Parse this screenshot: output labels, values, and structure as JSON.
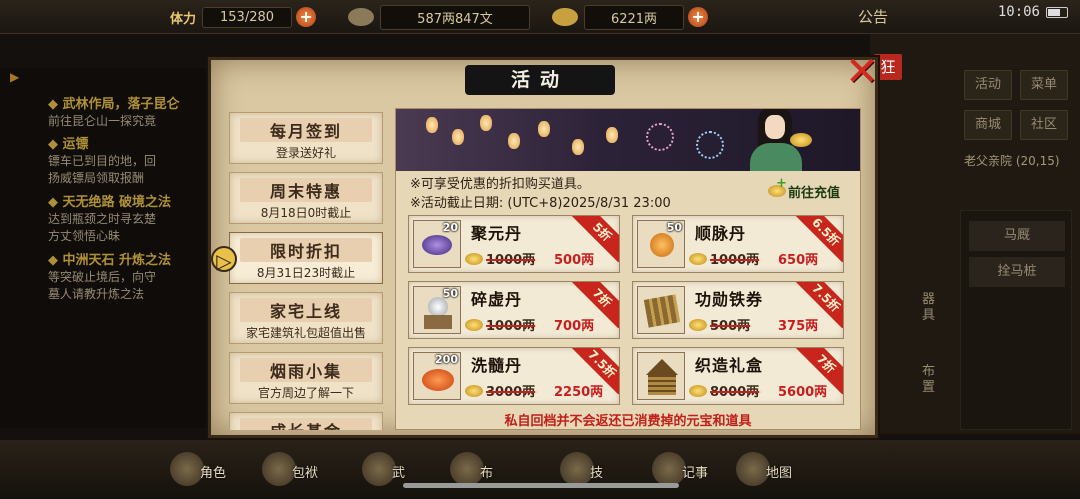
{
  "status_bar": {
    "stamina_label": "体力",
    "stamina_value": "153/280",
    "silver_value": "587两847文",
    "gold_value": "6221两",
    "announcement": "公告",
    "time": "10:06"
  },
  "quests": [
    {
      "title": "◆ 武林作局，落子昆仑",
      "desc": "前往昆仑山一探究竟"
    },
    {
      "title": "◆ 运镖",
      "desc": "镖车已到目的地，回\n扬威镖局领取报酬"
    },
    {
      "title": "◆ 天无绝路 破境之法",
      "desc": "达到瓶颈之时寻玄楚\n方丈领悟心昧"
    },
    {
      "title": "◆ 中洲天石 升炼之法",
      "desc": "等突破止境后，向守\n墓人请教升炼之法"
    }
  ],
  "right_panel": {
    "buttons": [
      "活动",
      "菜单",
      "商城",
      "社区"
    ],
    "location": "老父亲院 (20,15)",
    "list_items": [
      "马厩",
      "拴马桩"
    ],
    "side_labels": [
      "器具",
      "布置"
    ]
  },
  "bottom_nav": [
    "角色",
    "包袱",
    "武",
    "布",
    "技",
    "记事",
    "地图"
  ],
  "dialog": {
    "title": "活动",
    "close_label": "✕",
    "kuang_label": "狂",
    "tabs": [
      {
        "title": "每月签到",
        "subtitle": "登录送好礼"
      },
      {
        "title": "周末特惠",
        "subtitle": "8月18日0时截止"
      },
      {
        "title": "限时折扣",
        "subtitle": "8月31日23时截止"
      },
      {
        "title": "家宅上线",
        "subtitle": "家宅建筑礼包超值出售"
      },
      {
        "title": "烟雨小集",
        "subtitle": "官方周边了解一下"
      },
      {
        "title": "成长基金",
        "subtitle": ""
      }
    ],
    "active_tab": 2,
    "info_line1": "※可享受优惠的折扣购买道具。",
    "info_line2": "※活动截止日期: (UTC+8)2025/8/31 23:00",
    "recharge_label": "前往充值",
    "items": [
      {
        "name": "聚元丹",
        "qty": "20",
        "old_price": "1000两",
        "new_price": "500两",
        "discount": "5折"
      },
      {
        "name": "顺脉丹",
        "qty": "50",
        "old_price": "1000两",
        "new_price": "650两",
        "discount": "6.5折"
      },
      {
        "name": "碎虚丹",
        "qty": "50",
        "old_price": "1000两",
        "new_price": "700两",
        "discount": "7折"
      },
      {
        "name": "功勋铁券",
        "qty": "",
        "old_price": "500两",
        "new_price": "375两",
        "discount": "7.5折"
      },
      {
        "name": "洗髓丹",
        "qty": "200",
        "old_price": "3000两",
        "new_price": "2250两",
        "discount": "7.5折"
      },
      {
        "name": "织造礼盒",
        "qty": "",
        "old_price": "8000两",
        "new_price": "5600两",
        "discount": "7折"
      }
    ],
    "footer_note": "私自回档并不会返还已消费掉的元宝和道具"
  },
  "colors": {
    "accent_red": "#c81e1e",
    "title_bar": "#141414",
    "parchment": "#d9c8a2"
  }
}
